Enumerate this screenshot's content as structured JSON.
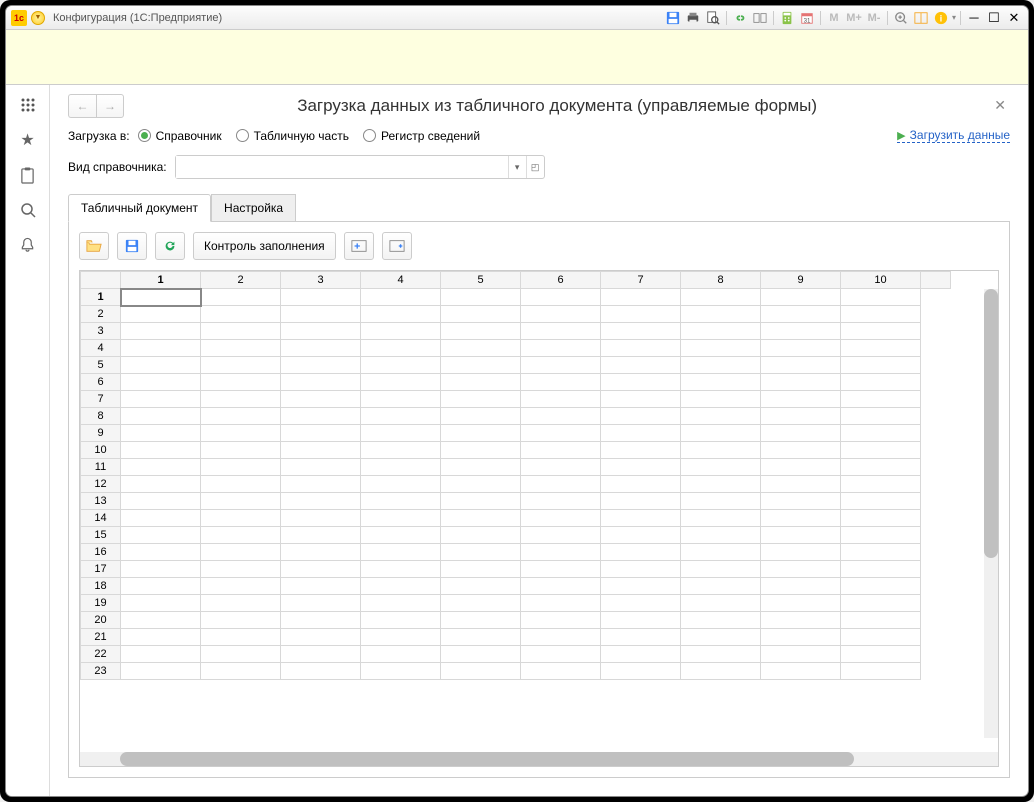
{
  "window": {
    "title": "Конфигурация  (1С:Предприятие)"
  },
  "page": {
    "title": "Загрузка данных из табличного документа (управляемые формы)",
    "load_to_label": "Загрузка в:",
    "radios": {
      "ref": "Справочник",
      "tab": "Табличную часть",
      "reg": "Регистр сведений"
    },
    "load_link": "Загрузить данные",
    "ref_kind_label": "Вид справочника:",
    "ref_kind_value": ""
  },
  "tabs": {
    "doc": "Табличный документ",
    "settings": "Настройка"
  },
  "toolbar": {
    "check_fill": "Контроль заполнения"
  },
  "grid": {
    "cols": [
      "1",
      "2",
      "3",
      "4",
      "5",
      "6",
      "7",
      "8",
      "9",
      "10"
    ],
    "rows": [
      "1",
      "2",
      "3",
      "4",
      "5",
      "6",
      "7",
      "8",
      "9",
      "10",
      "11",
      "12",
      "13",
      "14",
      "15",
      "16",
      "17",
      "18",
      "19",
      "20",
      "21",
      "22",
      "23"
    ]
  },
  "tibar_m": {
    "m": "M",
    "mplus": "M+",
    "mminus": "M-"
  }
}
